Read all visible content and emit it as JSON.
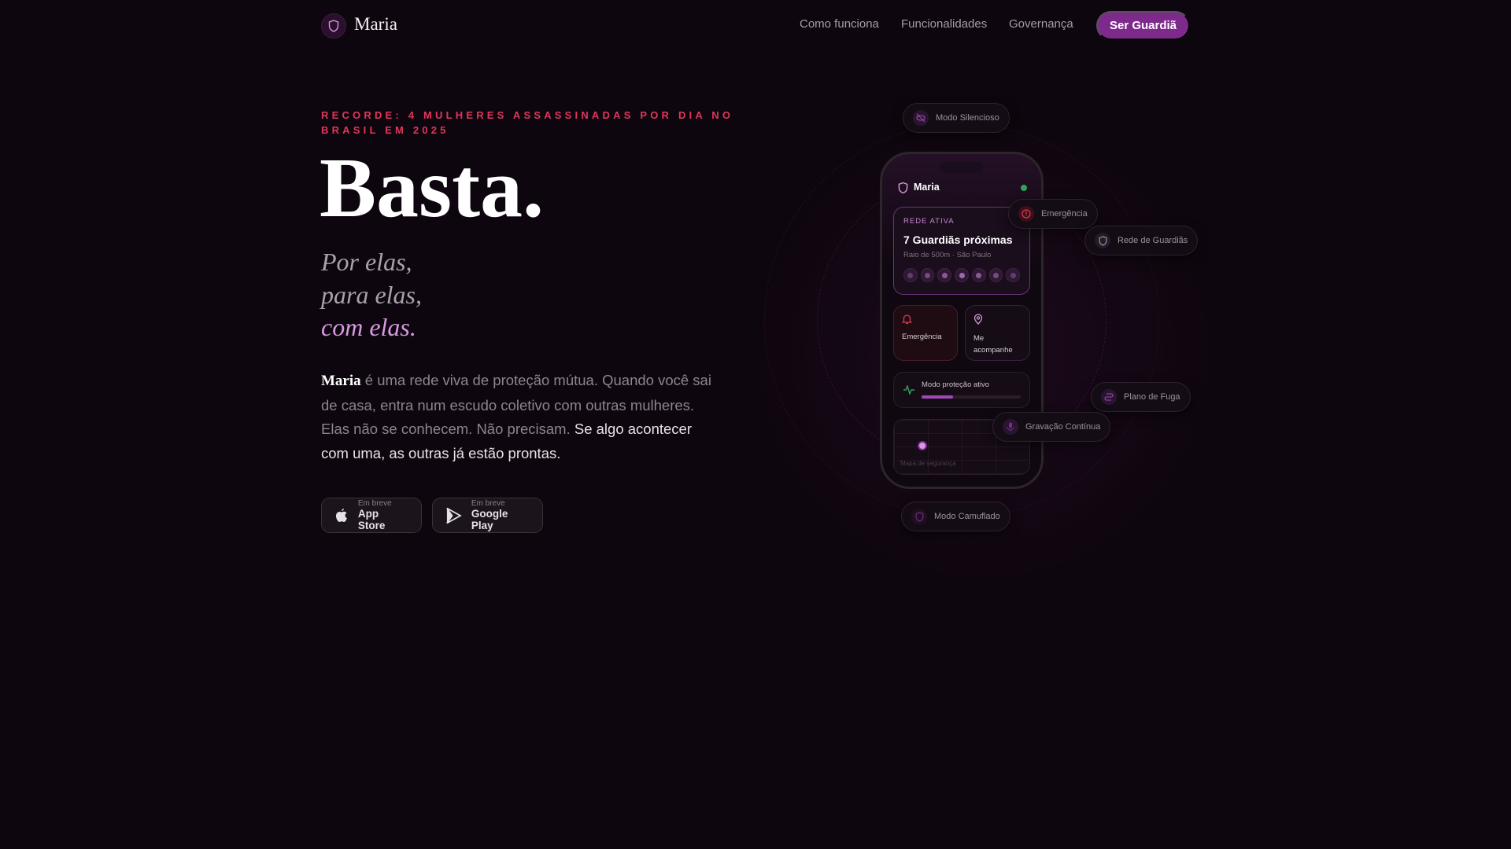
{
  "nav": {
    "brand": "Maria",
    "links": [
      "Como funciona",
      "Funcionalidades",
      "Governança"
    ],
    "cta": "Ser Guardiã"
  },
  "hero": {
    "eyebrow": "RECORDE: 4 MULHERES ASSASSINADAS POR DIA NO BRASIL EM 2025",
    "title": "Basta.",
    "tagline": [
      "Por elas,",
      "para elas,",
      "com elas."
    ],
    "para_brand": "Maria",
    "para_muted": " é uma rede viva de proteção mútua. Quando você sai de casa, entra num escudo coletivo com outras mulheres. Elas não se conhecem. Não precisam. ",
    "para_strong": "Se algo acontecer com uma, as outras já estão prontas.",
    "stores": [
      {
        "small": "Em breve",
        "name": "App Store",
        "icon": "apple-icon"
      },
      {
        "small": "Em breve",
        "name": "Google Play",
        "icon": "play-icon"
      }
    ]
  },
  "phone": {
    "app_name": "Maria",
    "network": {
      "label": "REDE ATIVA",
      "title": "7 Guardiãs próximas",
      "subtitle": "Raio de 500m · São Paulo",
      "guardians": 7
    },
    "actions": [
      {
        "label": "Emergência",
        "icon": "bell-icon"
      },
      {
        "label": "Me acompanhe",
        "icon": "map-pin-icon"
      }
    ],
    "protection": {
      "label": "Modo proteção ativo",
      "progress": 0.32
    },
    "map_label": "Mapa de segurança"
  },
  "features": [
    "Modo Silencioso",
    "Emergência",
    "Rede de Guardiãs",
    "Plano de Fuga",
    "Gravação Contínua",
    "Modo Camuflado"
  ],
  "colors": {
    "accent": "#7e2a8c",
    "alert": "#e0365a",
    "lilac": "#d79ae0",
    "online": "#2fa35a"
  }
}
